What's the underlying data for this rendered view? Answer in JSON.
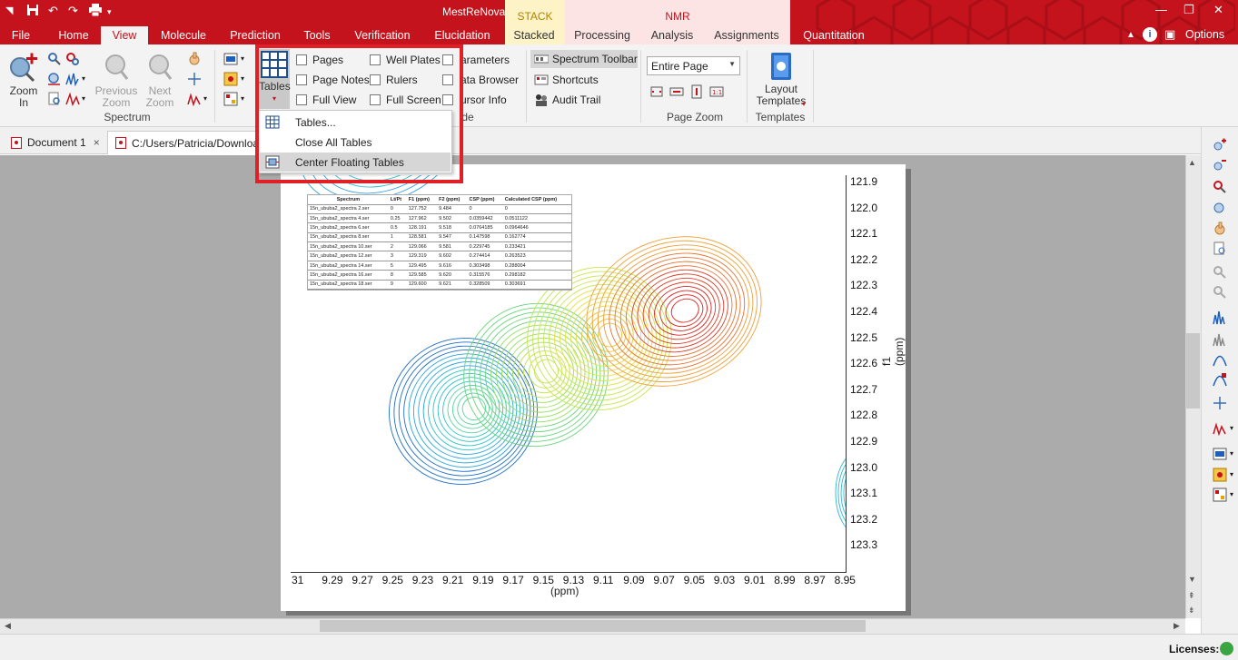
{
  "app_title": "MestReNova",
  "quick_access": {
    "save": "save-icon",
    "undo": "undo-icon",
    "redo": "redo-icon",
    "print": "print-icon"
  },
  "tabs": [
    {
      "label": "File"
    },
    {
      "label": "Home"
    },
    {
      "label": "View"
    },
    {
      "label": "Molecule"
    },
    {
      "label": "Prediction"
    },
    {
      "label": "Tools"
    },
    {
      "label": "Verification"
    },
    {
      "label": "Elucidation"
    },
    {
      "label": "Stacked"
    },
    {
      "label": "Processing"
    },
    {
      "label": "Analysis"
    },
    {
      "label": "Assignments"
    },
    {
      "label": "Quantitation"
    }
  ],
  "context_groups": {
    "stack": "STACK",
    "nmr": "NMR"
  },
  "options_label": "Options",
  "ribbon": {
    "zoom_in": [
      "Zoom",
      "In"
    ],
    "previous_zoom": [
      "Previous",
      "Zoom"
    ],
    "next_zoom": [
      "Next",
      "Zoom"
    ],
    "spectrum_group": "Spectrum",
    "tables_label": "Tables",
    "checkboxes_col1": [
      "Pages",
      "Page Notes",
      "Full View"
    ],
    "checkboxes_col2": [
      "Well Plates",
      "Rulers",
      "Full Screen"
    ],
    "panels": [
      "arameters",
      "ata Browser",
      "ursor Info"
    ],
    "show_group_partial": "de",
    "spectrum_toolbar": "Spectrum Toolbar",
    "shortcuts": "Shortcuts",
    "audit_trail": "Audit Trail",
    "page_zoom_value": "Entire Page",
    "page_zoom_group": "Page Zoom",
    "layout_templates": [
      "Layout",
      "Templates"
    ],
    "templates_group": "Templates"
  },
  "tables_menu": {
    "items": [
      {
        "label": "Tables...",
        "icon": "table-icon"
      },
      {
        "label": "Close All Tables",
        "icon": ""
      },
      {
        "label": "Center Floating Tables",
        "icon": "center-tables-icon"
      }
    ]
  },
  "doc_tabs": [
    {
      "label": "Document 1",
      "close": "×"
    },
    {
      "label": "C:/Users/Patricia/Downloa"
    }
  ],
  "spectrum": {
    "y_ticks": [
      "121.9",
      "122.0",
      "122.1",
      "122.2",
      "122.3",
      "122.4",
      "122.5",
      "122.6",
      "122.7",
      "122.8",
      "122.9",
      "123.0",
      "123.1",
      "123.2",
      "123.3"
    ],
    "x_ticks": [
      "31",
      "9.29",
      "9.27",
      "9.25",
      "9.23",
      "9.21",
      "9.19",
      "9.17",
      "9.15",
      "9.13",
      "9.11",
      "9.09",
      "9.07",
      "9.05",
      "9.03",
      "9.01",
      "8.99",
      "8.97",
      "8.95"
    ],
    "y_label": "f1 (ppm)",
    "x_label": "(ppm)"
  },
  "floating_table": {
    "headers": [
      "Spectrum",
      "Lt/Pt",
      "F1 (ppm)",
      "F2 (ppm)",
      "CSP (ppm)",
      "Calculated CSP (ppm)"
    ],
    "rows": [
      [
        "15n_ububa2_spectra 2.ser",
        "0",
        "127.752",
        "9.484",
        "0",
        "0"
      ],
      [
        "15n_ububa2_spectra 4.ser",
        "0.25",
        "127.962",
        "9.502",
        "0.0359442",
        "0.0511122"
      ],
      [
        "15n_ububa2_spectra 6.ser",
        "0.5",
        "128.191",
        "9.518",
        "0.0764185",
        "0.0964646"
      ],
      [
        "15n_ububa2_spectra 8.ser",
        "1",
        "128.581",
        "9.547",
        "0.147598",
        "0.162774"
      ],
      [
        "15n_ububa2_spectra 10.ser",
        "2",
        "129.066",
        "9.581",
        "0.229745",
        "0.233421"
      ],
      [
        "15n_ububa2_spectra 12.ser",
        "3",
        "129.319",
        "9.602",
        "0.274414",
        "0.263523"
      ],
      [
        "15n_ububa2_spectra 14.ser",
        "5",
        "129.495",
        "9.616",
        "0.303498",
        "0.288004"
      ],
      [
        "15n_ububa2_spectra 16.ser",
        "8",
        "129.585",
        "9.620",
        "0.315576",
        "0.298182"
      ],
      [
        "15n_ububa2_spectra 18.ser",
        "9",
        "129.600",
        "9.621",
        "0.328509",
        "0.303691"
      ]
    ]
  },
  "status": {
    "licenses": "Licenses:"
  },
  "colors": {
    "brand_red": "#c4131c",
    "stack_bg": "#fdf3c6",
    "nmr_bg": "#fde4e4",
    "highlight": "#e01f26"
  }
}
